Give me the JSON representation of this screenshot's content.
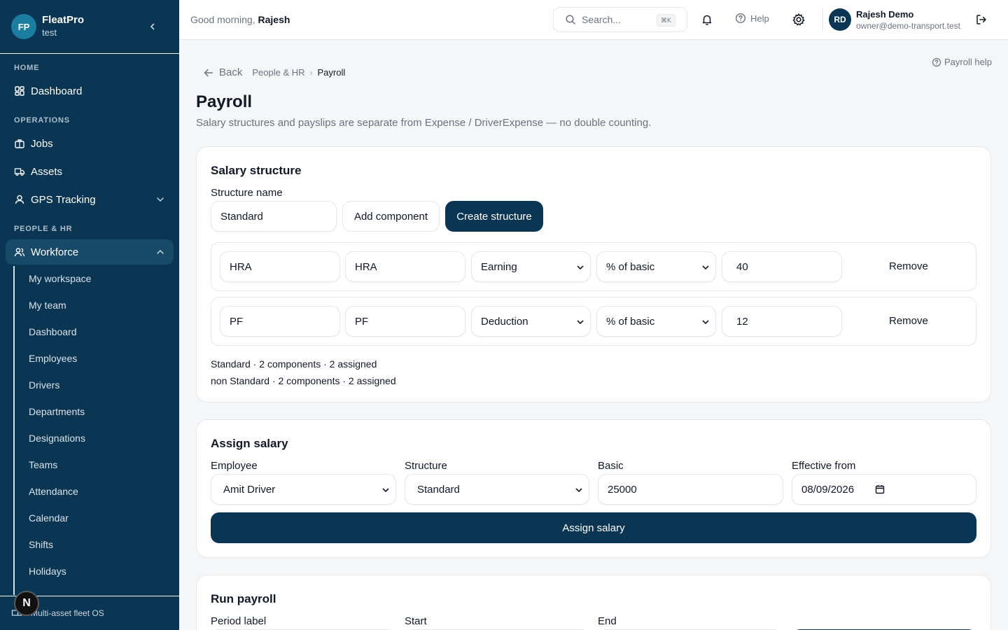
{
  "app": {
    "brand_initials": "FP",
    "brand_name": "FleatPro",
    "brand_sub": "test"
  },
  "sidebar": {
    "sections": {
      "home": "HOME",
      "operations": "OPERATIONS",
      "people": "PEOPLE & HR"
    },
    "items": [
      {
        "label": "Dashboard"
      },
      {
        "label": "Jobs"
      },
      {
        "label": "Assets"
      },
      {
        "label": "GPS Tracking"
      },
      {
        "label": "Workforce"
      }
    ],
    "subitems": [
      "My workspace",
      "My team",
      "Dashboard",
      "Employees",
      "Drivers",
      "Departments",
      "Designations",
      "Teams",
      "Attendance",
      "Calendar",
      "Shifts",
      "Holidays"
    ],
    "footer_text": "Multi-asset fleet OS",
    "n_badge": "N"
  },
  "topbar": {
    "greeting_prefix": "Good morning,",
    "greeting_name": "Rajesh",
    "search_placeholder": "Search...",
    "search_shortcut": "⌘K",
    "help_label": "Help",
    "user_initials": "RD",
    "user_name": "Rajesh Demo",
    "user_email": "owner@demo-transport.test"
  },
  "page": {
    "back_label": "Back",
    "breadcrumb_parent": "People & HR",
    "breadcrumb_current": "Payroll",
    "help_link": "Payroll help",
    "title": "Payroll",
    "subtitle": "Salary structures and payslips are separate from Expense / DriverExpense — no double counting."
  },
  "salary_structure": {
    "title": "Salary structure",
    "name_label": "Structure name",
    "name_value": "Standard",
    "add_component_label": "Add component",
    "create_label": "Create structure",
    "components": [
      {
        "code": "HRA",
        "name": "HRA",
        "type": "Earning",
        "calc": "% of basic",
        "value": "40",
        "remove_label": "Remove"
      },
      {
        "code": "PF",
        "name": "PF",
        "type": "Deduction",
        "calc": "% of basic",
        "value": "12",
        "remove_label": "Remove"
      }
    ],
    "existing": [
      "Standard · 2 components · 2 assigned",
      "non Standard · 2 components · 2 assigned"
    ]
  },
  "assign_salary": {
    "title": "Assign salary",
    "employee_label": "Employee",
    "employee_value": "Amit Driver",
    "structure_label": "Structure",
    "structure_value": "Standard",
    "basic_label": "Basic",
    "basic_value": "25000",
    "effective_label": "Effective from",
    "effective_value": "08/09/2026",
    "submit_label": "Assign salary"
  },
  "run_payroll": {
    "title": "Run payroll",
    "period_label": "Period label",
    "start_label": "Start",
    "end_label": "End"
  },
  "colors": {
    "sidebar_bg": "#0b3653",
    "brand_badge": "#1b7ea1",
    "primary": "#0b3653"
  }
}
